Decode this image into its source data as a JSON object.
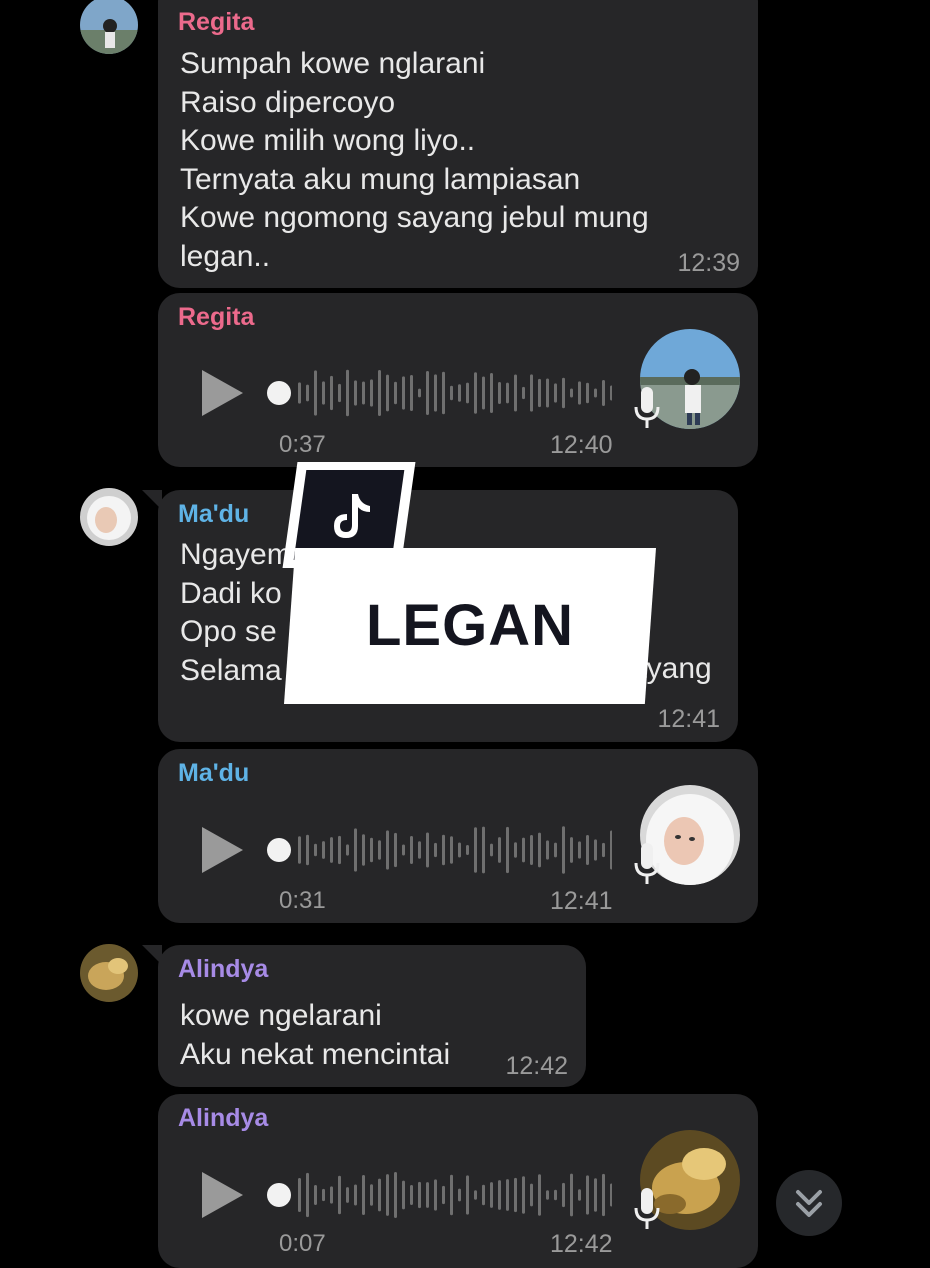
{
  "colors": {
    "regita": "#ec6a8c",
    "madu": "#5fb3e6",
    "alindya": "#a78be6",
    "bubble": "#262628",
    "time": "#9a9a9a"
  },
  "messages": [
    {
      "sender": "Regita",
      "text": "Sumpah kowe nglarani\nRaiso dipercoyo\nKowe milih wong liyo..\nTernyata aku mung lampiasan\nKowe ngomong sayang jebul mung\nlegan..",
      "time": "12:39"
    },
    {
      "sender": "Regita",
      "voice": true,
      "duration": "0:37",
      "time": "12:40"
    },
    {
      "sender": "Ma'du",
      "text": "Ngayem\nDadi ko\nOpo se\nSelama",
      "text_right_fragment": "ayang",
      "time": "12:41"
    },
    {
      "sender": "Ma'du",
      "voice": true,
      "duration": "0:31",
      "time": "12:41"
    },
    {
      "sender": "Alindya",
      "text": "kowe ngelarani\nAku nekat mencintai",
      "time": "12:42"
    },
    {
      "sender": "Alindya",
      "voice": true,
      "duration": "0:07",
      "time": "12:42"
    }
  ],
  "overlay": {
    "title": "LEGAN",
    "logo_icon": "tiktok-icon"
  },
  "scroll_button_icon": "double-chevron-down-icon"
}
